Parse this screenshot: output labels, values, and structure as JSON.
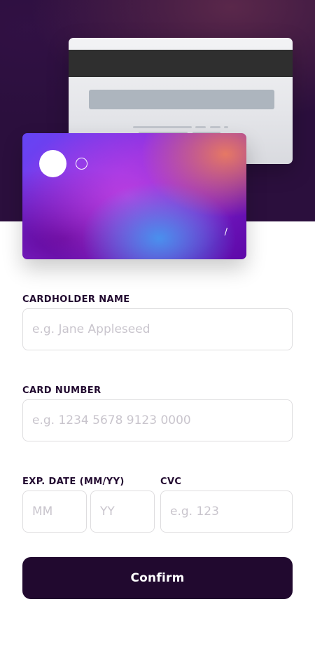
{
  "card_preview": {
    "number": "",
    "name": "",
    "exp_month": "",
    "exp_separator": "/",
    "exp_year": "",
    "cvc": ""
  },
  "form": {
    "cardholder_name": {
      "label": "CARDHOLDER NAME",
      "placeholder": "e.g. Jane Appleseed",
      "value": ""
    },
    "card_number": {
      "label": "CARD NUMBER",
      "placeholder": "e.g. 1234 5678 9123 0000",
      "value": ""
    },
    "exp_date": {
      "label": "EXP. DATE (MM/YY)",
      "month_placeholder": "MM",
      "year_placeholder": "YY",
      "month_value": "",
      "year_value": ""
    },
    "cvc": {
      "label": "CVC",
      "placeholder": "e.g. 123",
      "value": ""
    },
    "confirm_label": "Confirm"
  },
  "colors": {
    "dark_violet": "#21092f",
    "input_border": "#dedddf",
    "placeholder": "#c9c5cd",
    "card_back": "#e4e5e9",
    "mag_stripe": "#2f2f2f",
    "cvc_strip": "#adb5be"
  },
  "icons": {
    "card_logo_large": "filled-circle-icon",
    "card_logo_small": "outline-circle-icon"
  }
}
